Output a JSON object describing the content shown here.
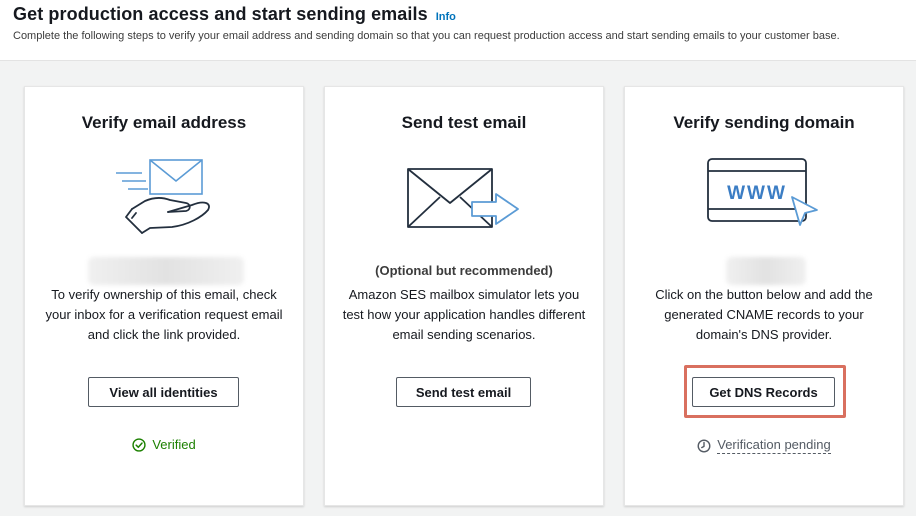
{
  "header": {
    "title": "Get production access and start sending emails",
    "info_link": "Info",
    "subtitle": "Complete the following steps to verify your email address and sending domain so that you can request production access and start sending emails to your customer base."
  },
  "cards": [
    {
      "title": "Verify email address",
      "text": "To verify ownership of this email, check your inbox for a verification request email and click the link provided.",
      "button_label": "View all identities",
      "status_label": "Verified",
      "status_color": "#1d8102",
      "icon": "email-hand-icon"
    },
    {
      "title": "Send test email",
      "optional_note": "(Optional but recommended)",
      "text": "Amazon SES mailbox simulator lets you test how your application handles different email sending scenarios.",
      "button_label": "Send test email",
      "icon": "envelope-arrow-icon"
    },
    {
      "title": "Verify sending domain",
      "text": "Click on the button below and add the generated CNAME records to your domain's DNS provider.",
      "button_label": "Get DNS Records",
      "status_label": "Verification pending",
      "status_color": "#545b64",
      "highlight_color": "#d9705f",
      "icon_text": "WWW",
      "icon": "browser-www-icon"
    }
  ],
  "colors": {
    "accent_link": "#0073bb",
    "background": "#f2f3f3"
  }
}
